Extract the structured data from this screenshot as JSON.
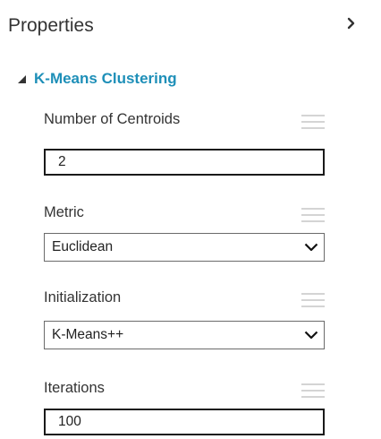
{
  "panel": {
    "title": "Properties"
  },
  "section": {
    "title": "K-Means Clustering"
  },
  "fields": {
    "centroids": {
      "label": "Number of Centroids",
      "value": "2"
    },
    "metric": {
      "label": "Metric",
      "selected": "Euclidean"
    },
    "initialization": {
      "label": "Initialization",
      "selected": "K-Means++"
    },
    "iterations": {
      "label": "Iterations",
      "value": "100"
    }
  },
  "icons": {
    "collapse": "chevron-right-icon",
    "section_toggle": "triangle-expanded-icon",
    "field_menu": "hamburger-menu-icon",
    "dropdown": "chevron-down-icon"
  },
  "colors": {
    "section_title": "#1e8fb8",
    "menu_icon": "#d4d4d4"
  }
}
